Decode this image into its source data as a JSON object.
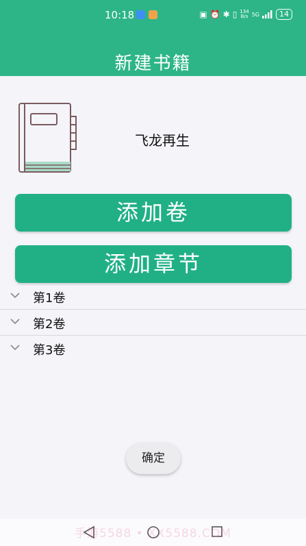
{
  "status_bar": {
    "time": "10:18",
    "net_speed_top": "134",
    "net_speed_bottom": "B/s",
    "network": "5G",
    "battery": "14"
  },
  "header": {
    "title": "新建书籍"
  },
  "book": {
    "name": "飞龙再生"
  },
  "buttons": {
    "add_volume": "添加卷",
    "add_chapter": "添加章节",
    "confirm": "确定"
  },
  "volumes": [
    {
      "label": "第1卷"
    },
    {
      "label": "第2卷"
    },
    {
      "label": "第3卷"
    }
  ],
  "watermark": "手游5588 • XX5588.COM",
  "colors": {
    "primary": "#2db587",
    "button": "#21b086",
    "background": "#f4f4f9"
  }
}
